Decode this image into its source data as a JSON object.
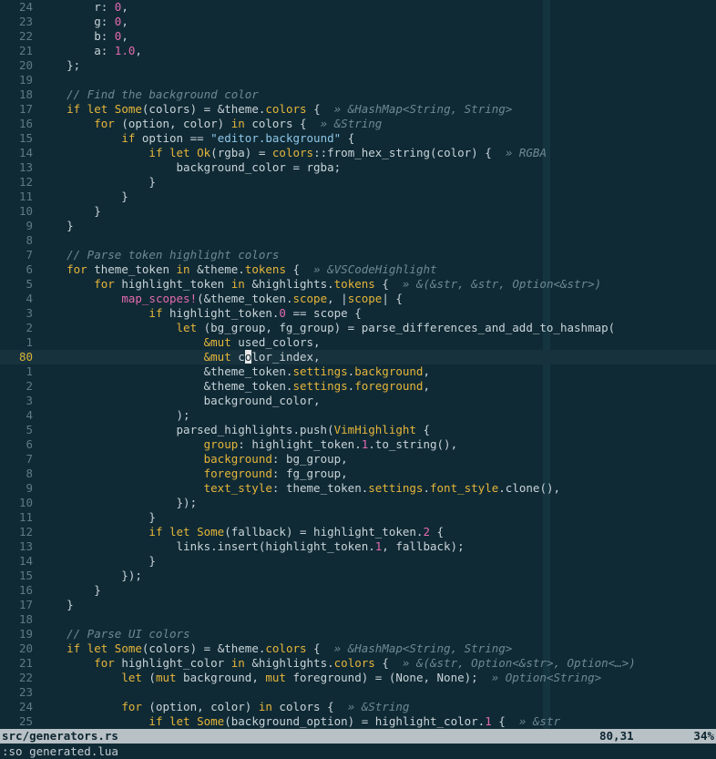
{
  "editor": {
    "current_line_index": 24,
    "lines": [
      {
        "num": "24",
        "tokens": [
          [
            "        r: ",
            "plain"
          ],
          [
            "0",
            "num"
          ],
          [
            ",",
            "plain"
          ]
        ]
      },
      {
        "num": "23",
        "tokens": [
          [
            "        g: ",
            "plain"
          ],
          [
            "0",
            "num"
          ],
          [
            ",",
            "plain"
          ]
        ]
      },
      {
        "num": "22",
        "tokens": [
          [
            "        b: ",
            "plain"
          ],
          [
            "0",
            "num"
          ],
          [
            ",",
            "plain"
          ]
        ]
      },
      {
        "num": "21",
        "tokens": [
          [
            "        a: ",
            "plain"
          ],
          [
            "1.0",
            "num"
          ],
          [
            ",",
            "plain"
          ]
        ]
      },
      {
        "num": "20",
        "tokens": [
          [
            "    };",
            "plain"
          ]
        ]
      },
      {
        "num": "19",
        "tokens": []
      },
      {
        "num": "18",
        "tokens": [
          [
            "    // Find the background color",
            "com"
          ]
        ]
      },
      {
        "num": "17",
        "tokens": [
          [
            "    ",
            "plain"
          ],
          [
            "if let",
            "kw"
          ],
          [
            " ",
            "plain"
          ],
          [
            "Some",
            "type"
          ],
          [
            "(colors) = &",
            "plain"
          ],
          [
            "theme",
            "plain"
          ],
          [
            ".",
            "plain"
          ],
          [
            "colors",
            "prop"
          ],
          [
            " {  ",
            "plain"
          ],
          [
            "» &HashMap<String, String>",
            "hint"
          ]
        ]
      },
      {
        "num": "16",
        "tokens": [
          [
            "        ",
            "plain"
          ],
          [
            "for",
            "kw"
          ],
          [
            " (option, color) ",
            "plain"
          ],
          [
            "in",
            "kw"
          ],
          [
            " colors {  ",
            "plain"
          ],
          [
            "» &String",
            "hint"
          ]
        ]
      },
      {
        "num": "15",
        "tokens": [
          [
            "            ",
            "plain"
          ],
          [
            "if",
            "kw"
          ],
          [
            " option == ",
            "plain"
          ],
          [
            "\"editor.background\"",
            "str"
          ],
          [
            " {",
            "plain"
          ]
        ]
      },
      {
        "num": "14",
        "tokens": [
          [
            "                ",
            "plain"
          ],
          [
            "if let",
            "kw"
          ],
          [
            " ",
            "plain"
          ],
          [
            "Ok",
            "type"
          ],
          [
            "(rgba) = ",
            "plain"
          ],
          [
            "colors",
            "type"
          ],
          [
            "::",
            "plain"
          ],
          [
            "from_hex_string",
            "fn"
          ],
          [
            "(color) {  ",
            "plain"
          ],
          [
            "» RGBA",
            "hint"
          ]
        ]
      },
      {
        "num": "13",
        "tokens": [
          [
            "                    background_color = rgba;",
            "plain"
          ]
        ]
      },
      {
        "num": "12",
        "tokens": [
          [
            "                }",
            "plain"
          ]
        ]
      },
      {
        "num": "11",
        "tokens": [
          [
            "            }",
            "plain"
          ]
        ]
      },
      {
        "num": "10",
        "tokens": [
          [
            "        }",
            "plain"
          ]
        ]
      },
      {
        "num": "9",
        "tokens": [
          [
            "    }",
            "plain"
          ]
        ]
      },
      {
        "num": "8",
        "tokens": []
      },
      {
        "num": "7",
        "tokens": [
          [
            "    // Parse token highlight colors",
            "com"
          ]
        ]
      },
      {
        "num": "6",
        "tokens": [
          [
            "    ",
            "plain"
          ],
          [
            "for",
            "kw"
          ],
          [
            " theme_token ",
            "plain"
          ],
          [
            "in",
            "kw"
          ],
          [
            " &theme.",
            "plain"
          ],
          [
            "tokens",
            "prop"
          ],
          [
            " {  ",
            "plain"
          ],
          [
            "» &VSCodeHighlight",
            "hint"
          ]
        ]
      },
      {
        "num": "5",
        "tokens": [
          [
            "        ",
            "plain"
          ],
          [
            "for",
            "kw"
          ],
          [
            " highlight_token ",
            "plain"
          ],
          [
            "in",
            "kw"
          ],
          [
            " &highlights.",
            "plain"
          ],
          [
            "tokens",
            "prop"
          ],
          [
            " {  ",
            "plain"
          ],
          [
            "» &(&str, &str, Option<&str>)",
            "hint"
          ]
        ]
      },
      {
        "num": "4",
        "tokens": [
          [
            "            ",
            "plain"
          ],
          [
            "map_scopes!",
            "mac"
          ],
          [
            "(&theme_token.",
            "plain"
          ],
          [
            "scope",
            "prop"
          ],
          [
            ", |",
            "plain"
          ],
          [
            "scope",
            "prop"
          ],
          [
            "| {",
            "plain"
          ]
        ]
      },
      {
        "num": "3",
        "tokens": [
          [
            "                ",
            "plain"
          ],
          [
            "if",
            "kw"
          ],
          [
            " highlight_token.",
            "plain"
          ],
          [
            "0",
            "num"
          ],
          [
            " == scope {",
            "plain"
          ]
        ]
      },
      {
        "num": "2",
        "tokens": [
          [
            "                    ",
            "plain"
          ],
          [
            "let",
            "kw"
          ],
          [
            " (bg_group, fg_group) = ",
            "plain"
          ],
          [
            "parse_differences_and_add_to_hashmap",
            "fn"
          ],
          [
            "(",
            "plain"
          ]
        ]
      },
      {
        "num": "1",
        "tokens": [
          [
            "                        ",
            "plain"
          ],
          [
            "&mut",
            "kw"
          ],
          [
            " used_colors,",
            "plain"
          ]
        ]
      },
      {
        "num": "80",
        "current": true,
        "tokens": [
          [
            "                        ",
            "plain"
          ],
          [
            "&mut",
            "kw"
          ],
          [
            " c",
            "plain"
          ],
          [
            "o",
            "cursor"
          ],
          [
            "lor_index,",
            "plain"
          ]
        ]
      },
      {
        "num": "1",
        "tokens": [
          [
            "                        &theme_token.",
            "plain"
          ],
          [
            "settings",
            "prop"
          ],
          [
            ".",
            "plain"
          ],
          [
            "background",
            "prop"
          ],
          [
            ",",
            "plain"
          ]
        ]
      },
      {
        "num": "2",
        "tokens": [
          [
            "                        &theme_token.",
            "plain"
          ],
          [
            "settings",
            "prop"
          ],
          [
            ".",
            "plain"
          ],
          [
            "foreground",
            "prop"
          ],
          [
            ",",
            "plain"
          ]
        ]
      },
      {
        "num": "3",
        "tokens": [
          [
            "                        background_color,",
            "plain"
          ]
        ]
      },
      {
        "num": "4",
        "tokens": [
          [
            "                    );",
            "plain"
          ]
        ]
      },
      {
        "num": "5",
        "tokens": [
          [
            "                    parsed_highlights.",
            "plain"
          ],
          [
            "push",
            "fn"
          ],
          [
            "(",
            "plain"
          ],
          [
            "VimHighlight",
            "type"
          ],
          [
            " {",
            "plain"
          ]
        ]
      },
      {
        "num": "6",
        "tokens": [
          [
            "                        ",
            "plain"
          ],
          [
            "group",
            "prop"
          ],
          [
            ": highlight_token.",
            "plain"
          ],
          [
            "1",
            "num"
          ],
          [
            ".",
            "plain"
          ],
          [
            "to_string",
            "fn"
          ],
          [
            "(),",
            "plain"
          ]
        ]
      },
      {
        "num": "7",
        "tokens": [
          [
            "                        ",
            "plain"
          ],
          [
            "background",
            "prop"
          ],
          [
            ": bg_group,",
            "plain"
          ]
        ]
      },
      {
        "num": "8",
        "tokens": [
          [
            "                        ",
            "plain"
          ],
          [
            "foreground",
            "prop"
          ],
          [
            ": fg_group,",
            "plain"
          ]
        ]
      },
      {
        "num": "9",
        "tokens": [
          [
            "                        ",
            "plain"
          ],
          [
            "text_style",
            "prop"
          ],
          [
            ": theme_token.",
            "plain"
          ],
          [
            "settings",
            "prop"
          ],
          [
            ".",
            "plain"
          ],
          [
            "font_style",
            "prop"
          ],
          [
            ".",
            "plain"
          ],
          [
            "clone",
            "fn"
          ],
          [
            "(),",
            "plain"
          ]
        ]
      },
      {
        "num": "10",
        "tokens": [
          [
            "                    });",
            "plain"
          ]
        ]
      },
      {
        "num": "11",
        "tokens": [
          [
            "                }",
            "plain"
          ]
        ]
      },
      {
        "num": "12",
        "tokens": [
          [
            "                ",
            "plain"
          ],
          [
            "if let",
            "kw"
          ],
          [
            " ",
            "plain"
          ],
          [
            "Some",
            "type"
          ],
          [
            "(fallback) = highlight_token.",
            "plain"
          ],
          [
            "2",
            "num"
          ],
          [
            " {",
            "plain"
          ]
        ]
      },
      {
        "num": "13",
        "tokens": [
          [
            "                    links.",
            "plain"
          ],
          [
            "insert",
            "fn"
          ],
          [
            "(highlight_token.",
            "plain"
          ],
          [
            "1",
            "num"
          ],
          [
            ", fallback);",
            "plain"
          ]
        ]
      },
      {
        "num": "14",
        "tokens": [
          [
            "                }",
            "plain"
          ]
        ]
      },
      {
        "num": "15",
        "tokens": [
          [
            "            });",
            "plain"
          ]
        ]
      },
      {
        "num": "16",
        "tokens": [
          [
            "        }",
            "plain"
          ]
        ]
      },
      {
        "num": "17",
        "tokens": [
          [
            "    }",
            "plain"
          ]
        ]
      },
      {
        "num": "18",
        "tokens": []
      },
      {
        "num": "19",
        "tokens": [
          [
            "    // Parse UI colors",
            "com"
          ]
        ]
      },
      {
        "num": "20",
        "tokens": [
          [
            "    ",
            "plain"
          ],
          [
            "if let",
            "kw"
          ],
          [
            " ",
            "plain"
          ],
          [
            "Some",
            "type"
          ],
          [
            "(colors) = &theme.",
            "plain"
          ],
          [
            "colors",
            "prop"
          ],
          [
            " {  ",
            "plain"
          ],
          [
            "» &HashMap<String, String>",
            "hint"
          ]
        ]
      },
      {
        "num": "21",
        "tokens": [
          [
            "        ",
            "plain"
          ],
          [
            "for",
            "kw"
          ],
          [
            " highlight_color ",
            "plain"
          ],
          [
            "in",
            "kw"
          ],
          [
            " &highlights.",
            "plain"
          ],
          [
            "colors",
            "prop"
          ],
          [
            " {  ",
            "plain"
          ],
          [
            "» &(&str, Option<&str>, Option<…>)",
            "hint"
          ]
        ]
      },
      {
        "num": "22",
        "tokens": [
          [
            "            ",
            "plain"
          ],
          [
            "let",
            "kw"
          ],
          [
            " (",
            "plain"
          ],
          [
            "mut",
            "kw"
          ],
          [
            " background, ",
            "plain"
          ],
          [
            "mut",
            "kw"
          ],
          [
            " foreground) = (None, None);  ",
            "plain"
          ],
          [
            "» Option<String>",
            "hint"
          ]
        ]
      },
      {
        "num": "23",
        "tokens": []
      },
      {
        "num": "24",
        "tokens": [
          [
            "            ",
            "plain"
          ],
          [
            "for",
            "kw"
          ],
          [
            " (option, color) ",
            "plain"
          ],
          [
            "in",
            "kw"
          ],
          [
            " colors {  ",
            "plain"
          ],
          [
            "» &String",
            "hint"
          ]
        ]
      },
      {
        "num": "25",
        "tokens": [
          [
            "                ",
            "plain"
          ],
          [
            "if let",
            "kw"
          ],
          [
            " ",
            "plain"
          ],
          [
            "Some",
            "type"
          ],
          [
            "(background_option) = highlight_color.",
            "plain"
          ],
          [
            "1",
            "num"
          ],
          [
            " {  ",
            "plain"
          ],
          [
            "» &str",
            "hint"
          ]
        ]
      }
    ]
  },
  "statusline": {
    "file": "src/generators.rs",
    "position": "80,31",
    "percent": "34%"
  },
  "cmdline": {
    "text": ":so generated.lua"
  },
  "colors": {
    "background": "#0f2a35",
    "current_line": "#17323d",
    "keyword": "#e6b53a",
    "number": "#e26ab0",
    "string": "#8fc6e8",
    "comment": "#6f8992",
    "statusline_bg": "#b8c1c6"
  }
}
